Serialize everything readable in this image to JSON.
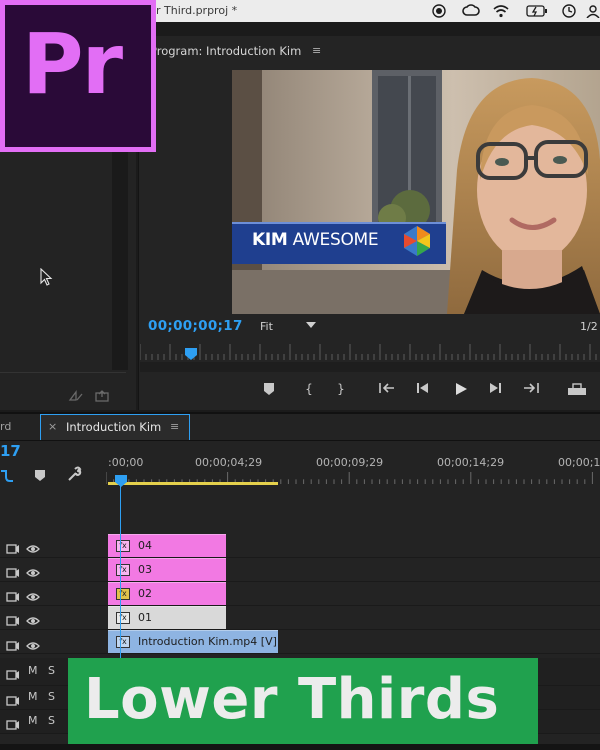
{
  "window": {
    "title_fragment": "r Third.prproj *"
  },
  "logo": {
    "text": "Pr",
    "color": "#e26ef5"
  },
  "program_monitor": {
    "tab_label": "Program: Introduction Kim",
    "menu_glyph": "≡",
    "timecode": "00;00;00;17",
    "zoom": "Fit",
    "resolution_fragment": "1/2",
    "lower_third": {
      "bold": "KIM",
      "rest": " AWESOME"
    }
  },
  "timeline": {
    "prev_tab_fragment": "rd",
    "tab_close": "×",
    "tab_label": "Introduction Kim",
    "tab_menu": "≡",
    "timecode_fragment": "17",
    "ruler_labels": [
      ":00;00",
      "00;00;04;29",
      "00;00;09;29",
      "00;00;14;29",
      "00;00;1"
    ],
    "tracks": [
      {
        "clip": "04",
        "color": "#f279e3"
      },
      {
        "clip": "03",
        "color": "#f279e3"
      },
      {
        "clip": "02",
        "color": "#f279e3"
      },
      {
        "clip": "01",
        "color": "#d9d9d9"
      },
      {
        "clip": "Introduction Kim.mp4 [V]",
        "color": "#8eb4e2"
      }
    ],
    "audio_track_labels": [
      "M",
      "S"
    ]
  },
  "banner": {
    "text": "Lower Thirds",
    "color": "#20a14e"
  }
}
